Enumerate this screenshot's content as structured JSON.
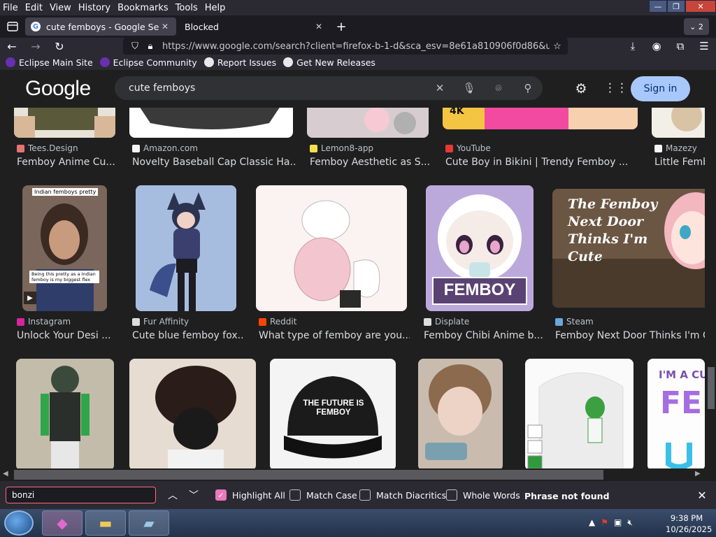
{
  "menu": [
    "File",
    "Edit",
    "View",
    "History",
    "Bookmarks",
    "Tools",
    "Help"
  ],
  "window_controls": {
    "minimize": "—",
    "maximize": "❐",
    "close": "✕"
  },
  "tabs": [
    {
      "title": "cute femboys - Google Search",
      "active": true
    },
    {
      "title": "Blocked",
      "active": false
    }
  ],
  "tab_count": "2",
  "url": "https://www.google.com/search?client=firefox-b-1-d&sca_esv=8e61a810906f0d86&udm=",
  "bookmarks": [
    {
      "label": "Eclipse Main Site",
      "color": "#8a3fd6"
    },
    {
      "label": "Eclipse Community",
      "color": "#8a3fd6"
    },
    {
      "label": "Report Issues",
      "color": "#e8e8e8"
    },
    {
      "label": "Get New Releases",
      "color": "#e8e8e8"
    }
  ],
  "google": {
    "logo": "Google",
    "query": "cute femboys",
    "signin": "Sign in"
  },
  "row1": [
    {
      "source": "Tees.Design",
      "title": "Femboy Anime Cu...",
      "color": "#e57373"
    },
    {
      "source": "Amazon.com",
      "title": "Novelty Baseball Cap Classic Ha...",
      "color": "#f5f5f5"
    },
    {
      "source": "Lemon8-app",
      "title": "Femboy Aesthetic as S...",
      "color": "#f4e04d"
    },
    {
      "source": "YouTube",
      "title": "Cute Boy in Bikini | Trendy Femboy ...",
      "color": "#e53935"
    },
    {
      "source": "Mazezy",
      "title": "Little Femb",
      "color": "#f5f5f5"
    }
  ],
  "row2": [
    {
      "source": "Instagram",
      "title": "Unlock Your Desi ...",
      "color": "#d6249f"
    },
    {
      "source": "Fur Affinity",
      "title": "Cute blue femboy fox...",
      "color": "#dddddd"
    },
    {
      "source": "Reddit",
      "title": "What type of femboy are you...",
      "color": "#ff4500"
    },
    {
      "source": "Displate",
      "title": "Femboy Chibi Anime b...",
      "color": "#dddddd"
    },
    {
      "source": "Steam",
      "title": "Femboy Next Door Thinks I'm Cu",
      "color": "#66aadd"
    }
  ],
  "thumb_text": {
    "indian_caption": "Indian femboys pretty",
    "indian_sub": "Being this pretty as a Indian femboy is my biggest flex",
    "chibi_label": "FEMBOY",
    "steam_title": "The Femboy Next Door Thinks I'm Cute",
    "cap_text": "THE FUTURE IS FEMBOY",
    "partial_label": "I'M A CUT",
    "partial_big": "FE",
    "yt_badge": "4K"
  },
  "findbar": {
    "value": "bonzi",
    "highlight_all": "Highlight All",
    "match_case": "Match Case",
    "match_diacritics": "Match Diacritics",
    "whole_words": "Whole Words",
    "status": "Phrase not found"
  },
  "clock": {
    "time": "9:38 PM",
    "date": "10/26/2025"
  }
}
